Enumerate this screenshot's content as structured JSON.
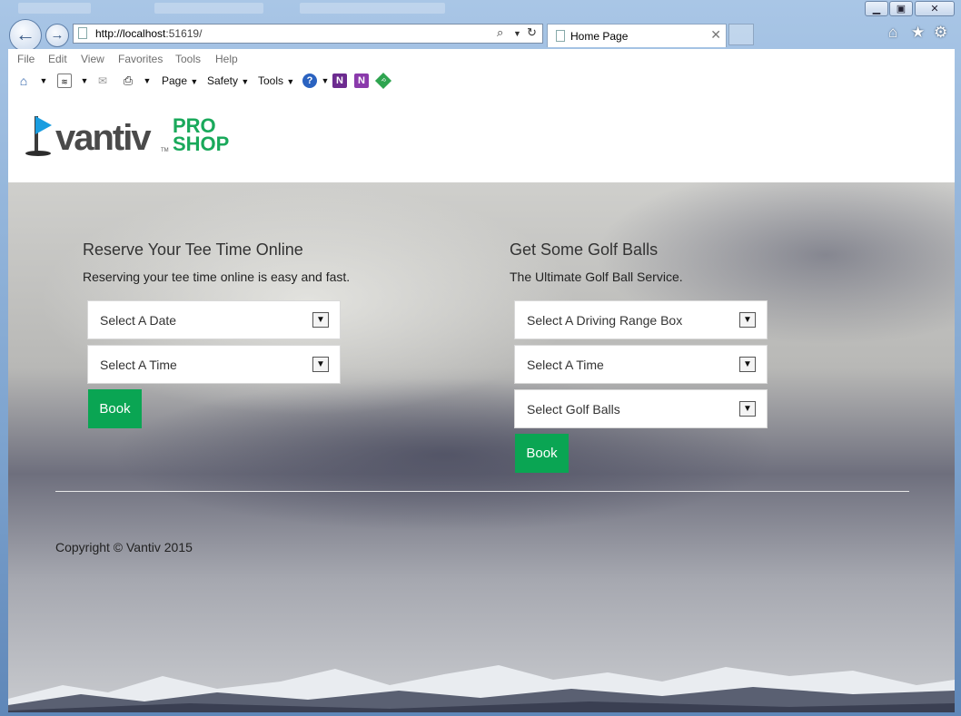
{
  "browser": {
    "address": {
      "url_host": "http://localhost",
      "url_rest": ":51619/"
    },
    "tab": {
      "title": "Home Page"
    },
    "menu": [
      "File",
      "Edit",
      "View",
      "Favorites",
      "Tools",
      "Help"
    ],
    "commands": {
      "page": "Page",
      "safety": "Safety",
      "tools": "Tools"
    }
  },
  "site": {
    "logo": {
      "brand": "vantiv",
      "tm": "TM",
      "pro": "PRO",
      "shop": "SHOP"
    },
    "tee": {
      "heading": "Reserve Your Tee Time Online",
      "subtitle": "Reserving your tee time online is easy and fast.",
      "date_select": "Select A Date",
      "time_select": "Select A Time",
      "book": "Book"
    },
    "balls": {
      "heading": "Get Some Golf Balls",
      "subtitle": "The Ultimate Golf Ball Service.",
      "box_select": "Select A Driving Range Box",
      "time_select": "Select A Time",
      "balls_select": "Select Golf Balls",
      "book": "Book"
    },
    "copyright": "Copyright © Vantiv 2015"
  },
  "colors": {
    "accent_green": "#0aa553",
    "logo_blue": "#1a9de0"
  }
}
